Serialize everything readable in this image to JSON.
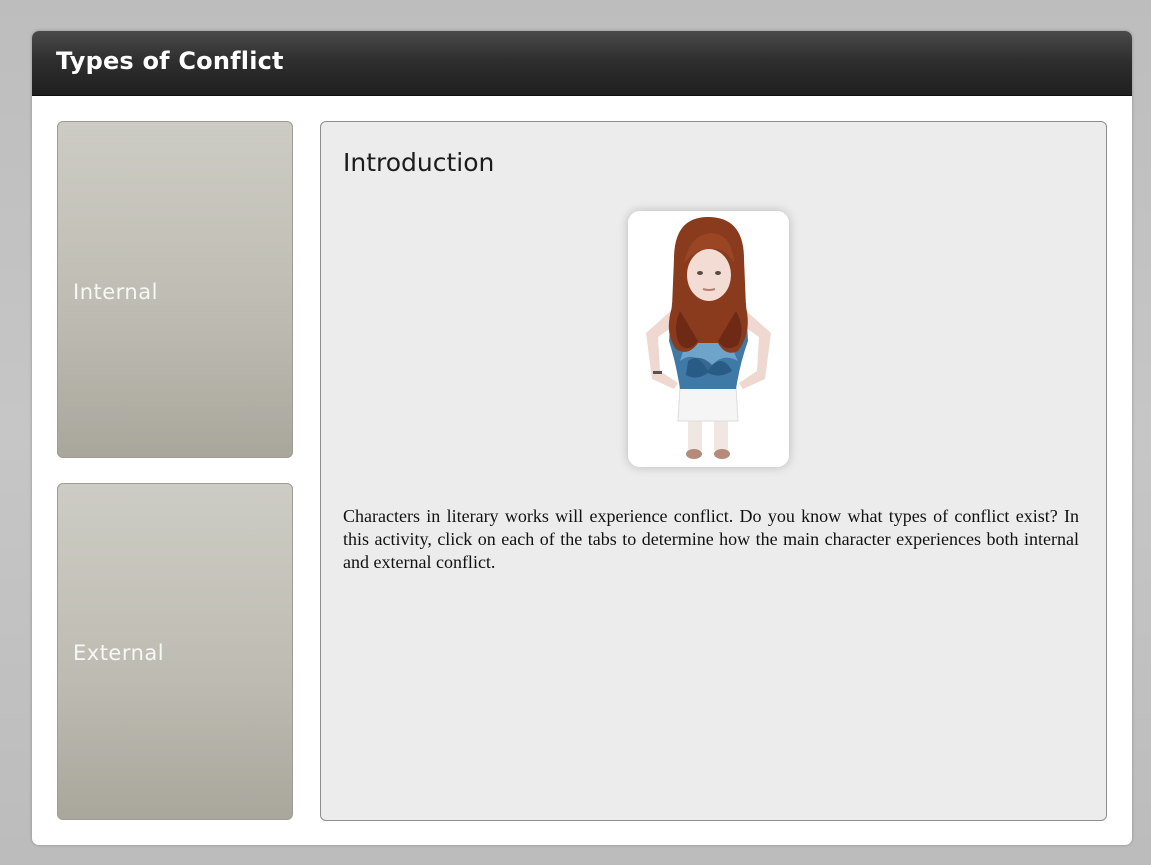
{
  "window": {
    "title": "Types of Conflict"
  },
  "tabs": [
    {
      "label": "Internal"
    },
    {
      "label": "External"
    }
  ],
  "content": {
    "heading": "Introduction",
    "image_icon": "girl-photo",
    "body": "Characters in literary works will experience conflict. Do you know what types of conflict exist? In this activity, click on each of the tabs to determine how the main character experiences both internal and external conflict."
  },
  "colors": {
    "title_bar": "#2f2f2f",
    "tab_background": "#bdbbb1",
    "panel_background": "#ececec"
  }
}
